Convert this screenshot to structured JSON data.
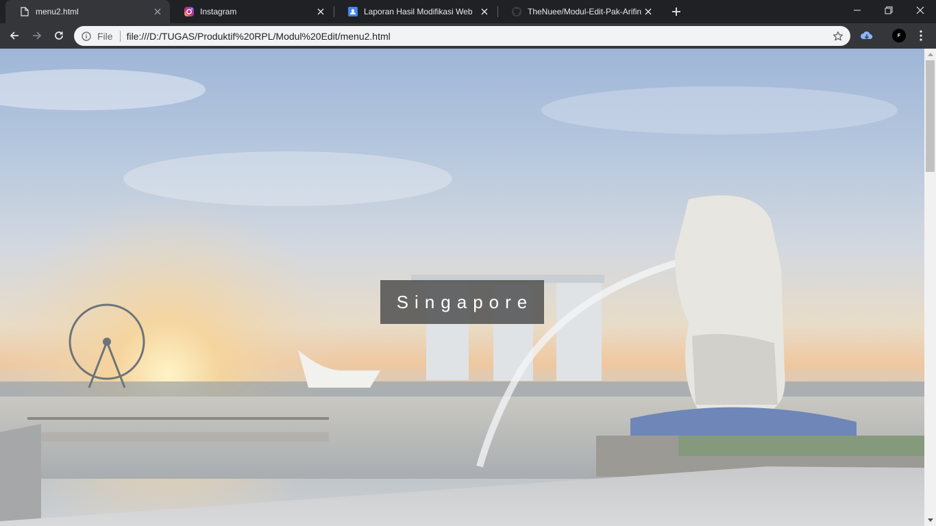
{
  "browser": {
    "tabs": [
      {
        "title": "menu2.html",
        "icon": "file-icon",
        "active": true
      },
      {
        "title": "Instagram",
        "icon": "instagram-icon",
        "active": false
      },
      {
        "title": "Laporan Hasil Modifikasi Web",
        "icon": "google-sites-icon",
        "active": false
      },
      {
        "title": "TheNuee/Modul-Edit-Pak-Arifin",
        "icon": "github-icon",
        "active": false
      }
    ],
    "omnibox": {
      "scheme_label": "File",
      "url": "file:///D:/TUGAS/Produktif%20RPL/Modul%20Edit/menu2.html"
    },
    "profile_initial": "F"
  },
  "page": {
    "caption": "Singapore",
    "background": "Singapore Marina Bay skyline at sunrise with Merlion fountain"
  },
  "colors": {
    "tabstrip": "#202124",
    "toolbar": "#35363a",
    "omnibox": "#f1f3f4",
    "caption_box": "#505050",
    "caption_text": "#ffffff"
  }
}
